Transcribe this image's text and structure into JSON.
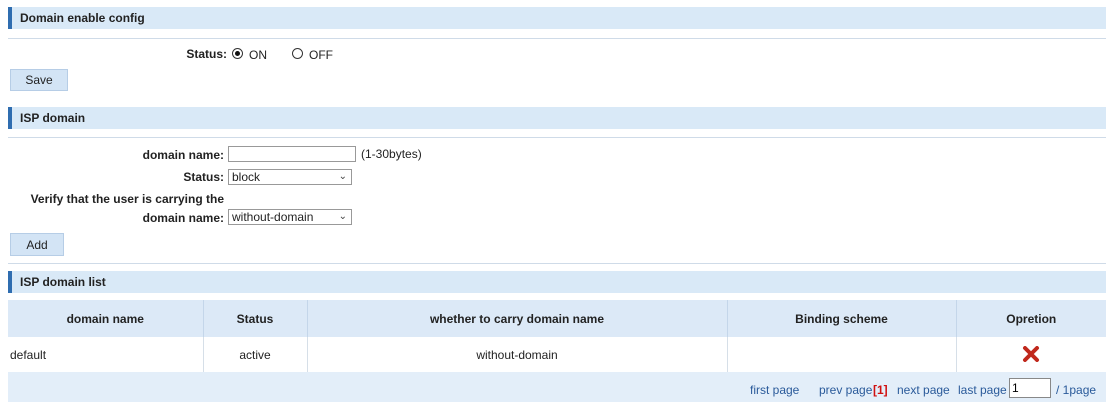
{
  "domain_enable": {
    "title": "Domain enable config",
    "status_label": "Status:",
    "on_label": "ON",
    "off_label": "OFF",
    "selected": "ON",
    "save_label": "Save"
  },
  "isp_domain": {
    "title": "ISP domain",
    "domain_name_label": "domain name:",
    "domain_name_value": "",
    "domain_name_hint": "(1-30bytes)",
    "status_label": "Status:",
    "status_value": "block",
    "verify_label_line1": "Verify that the user is carrying the",
    "verify_label_line2": "domain name:",
    "verify_value": "without-domain",
    "add_label": "Add"
  },
  "isp_domain_list": {
    "title": "ISP domain list",
    "columns": [
      "domain name",
      "Status",
      "whether to carry domain name",
      "Binding scheme",
      "Opretion"
    ],
    "rows": [
      [
        "default",
        "active",
        "without-domain",
        ""
      ]
    ]
  },
  "pagination": {
    "first": "first page",
    "prev": "prev page",
    "current": "[1]",
    "next": "next page",
    "last": "last page",
    "page_input": "1",
    "total": "/ 1page"
  },
  "colors": {
    "header_bg": "#d9e9f7",
    "header_accent": "#2f6db0",
    "button_bg": "#d3e4f5",
    "delete_icon": "#c0281c",
    "pager_current": "#d01010"
  },
  "icons": {
    "delete": "x-delete-icon"
  }
}
